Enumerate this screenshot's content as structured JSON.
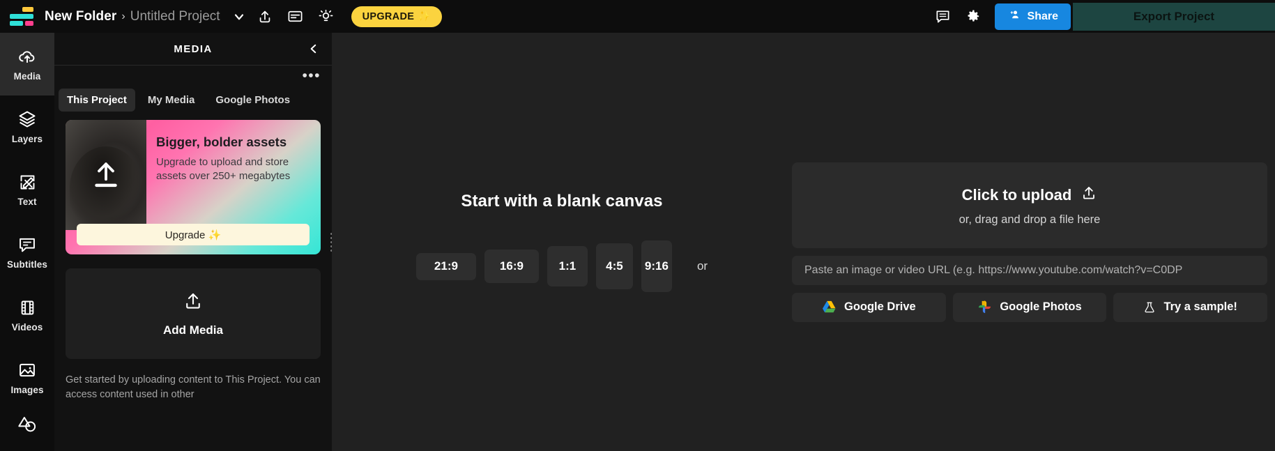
{
  "topbar": {
    "logo_name": "app-logo",
    "breadcrumb_folder": "New Folder",
    "breadcrumb_separator": "›",
    "breadcrumb_project": "Untitled Project",
    "chevron_icon": "chevron-down-icon",
    "share_export_icon": "share-export-icon",
    "captions_icon": "captions-icon",
    "ideas_icon": "lightbulb-icon",
    "upgrade_label": "UPGRADE",
    "upgrade_sparkle": "✨",
    "comment_icon": "comment-icon",
    "settings_icon": "gear-icon",
    "share_label": "Share",
    "share_icon": "add-person-icon",
    "export_label": "Export Project",
    "accent_blue": "#1787e0",
    "accent_yellow": "#fbd33f",
    "export_bg": "#1d4541"
  },
  "rail": {
    "items": [
      {
        "label": "Media",
        "icon": "upload-cloud-icon",
        "active": true
      },
      {
        "label": "Layers",
        "icon": "layers-icon",
        "active": false
      },
      {
        "label": "Text",
        "icon": "text-edit-icon",
        "active": false
      },
      {
        "label": "Subtitles",
        "icon": "subtitles-icon",
        "active": false
      },
      {
        "label": "Videos",
        "icon": "film-strip-icon",
        "active": false
      },
      {
        "label": "Images",
        "icon": "image-icon",
        "active": false
      },
      {
        "label": "",
        "icon": "shapes-icon",
        "active": false
      }
    ]
  },
  "panel": {
    "title": "MEDIA",
    "collapse_icon": "chevron-left-icon",
    "more_icon": "more-options-icon",
    "more_glyph": "•••",
    "tabs": [
      {
        "label": "This Project",
        "active": true
      },
      {
        "label": "My Media",
        "active": false
      },
      {
        "label": "Google Photos",
        "active": false
      }
    ],
    "promo": {
      "title": "Bigger, bolder assets",
      "subtitle": "Upgrade to upload and store assets over 250+ megabytes",
      "cta_label": "Upgrade ✨",
      "thumb_icon": "upload-arrow-icon"
    },
    "add_media": {
      "label": "Add Media",
      "icon": "upload-arrow-icon"
    },
    "help_text": "Get started by uploading content to This Project. You can access content used in other"
  },
  "canvas": {
    "blank_title": "Start with a blank canvas",
    "ratios": [
      "21:9",
      "16:9",
      "1:1",
      "4:5",
      "9:16"
    ],
    "or_word": "or",
    "upload": {
      "click_label": "Click to upload",
      "upload_icon": "upload-arrow-icon",
      "drag_label": "or, drag and drop a file here",
      "url_placeholder": "Paste an image or video URL (e.g. https://www.youtube.com/watch?v=C0DP",
      "sources": [
        {
          "label": "Google Drive",
          "icon": "google-drive-icon"
        },
        {
          "label": "Google Photos",
          "icon": "google-photos-icon"
        },
        {
          "label": "Try a sample!",
          "icon": "flask-icon"
        }
      ]
    }
  }
}
